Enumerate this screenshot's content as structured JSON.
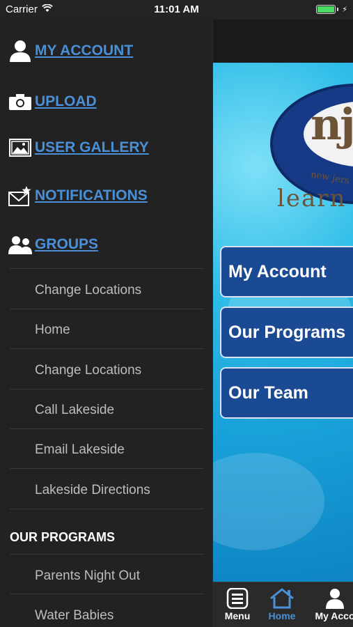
{
  "status": {
    "carrier": "Carrier",
    "time": "11:01 AM"
  },
  "drawer": {
    "top_items": [
      {
        "label": "MY ACCOUNT",
        "icon": "user-icon"
      },
      {
        "label": "UPLOAD",
        "icon": "camera-icon"
      },
      {
        "label": "USER GALLERY",
        "icon": "gallery-icon"
      },
      {
        "label": "NOTIFICATIONS",
        "icon": "notification-icon"
      },
      {
        "label": "GROUPS",
        "icon": "groups-icon"
      }
    ],
    "links": [
      "Change Locations",
      "Home",
      "Change Locations",
      "Call Lakeside",
      "Email Lakeside",
      "Lakeside Directions"
    ],
    "programs_heading": "OUR PROGRAMS",
    "program_links": [
      "Parents Night Out",
      "Water Babies"
    ]
  },
  "main": {
    "logo": {
      "letters": "njs",
      "tagline": "new jers",
      "word": "learn"
    },
    "tiles": [
      "My Account",
      "Our Programs",
      "Our Team"
    ],
    "tabs": [
      {
        "label": "Menu",
        "icon": "menu-icon",
        "active": false
      },
      {
        "label": "Home",
        "icon": "home-icon",
        "active": true
      },
      {
        "label": "My Acco",
        "icon": "user-icon",
        "active": false
      }
    ]
  },
  "colors": {
    "link_blue": "#4a90d9",
    "tile_blue": "#1b4a94",
    "battery_green": "#4cd964"
  }
}
